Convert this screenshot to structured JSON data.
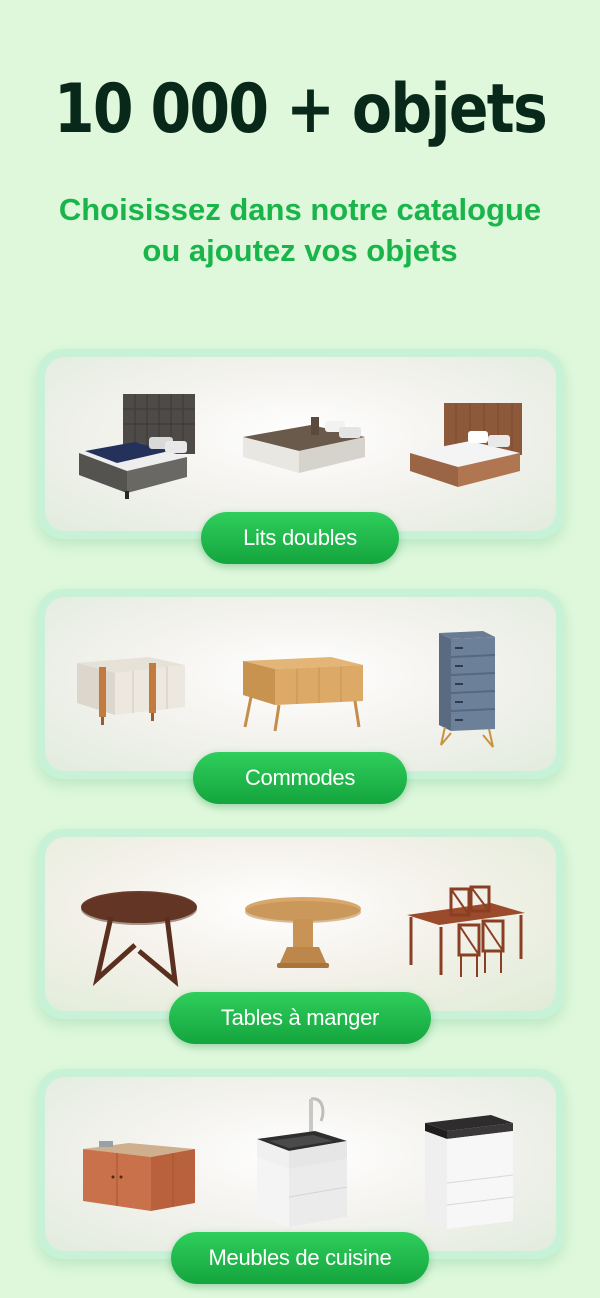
{
  "headline": "10 000 + objets",
  "subtitle_line1": "Choisissez dans notre catalogue",
  "subtitle_line2": "ou ajoutez vos objets",
  "categories": [
    {
      "label": "Lits doubles",
      "items": [
        "bed-upholstered-grey",
        "bed-platform-white",
        "bed-leather-brown"
      ]
    },
    {
      "label": "Commodes",
      "items": [
        "sideboard-white-wood",
        "sideboard-oak",
        "tall-chest-blue"
      ]
    },
    {
      "label": "Tables à manger",
      "items": [
        "round-table-walnut",
        "oval-pedestal-table",
        "dining-set-wood"
      ]
    },
    {
      "label": "Meubles de cuisine",
      "items": [
        "corner-kitchen-unit",
        "sink-cabinet-marble",
        "drawer-cabinet-marble"
      ]
    }
  ],
  "colors": {
    "background": "#dff8dc",
    "headline": "#08291a",
    "accent": "#19b54a",
    "pill": "#1cb046"
  }
}
